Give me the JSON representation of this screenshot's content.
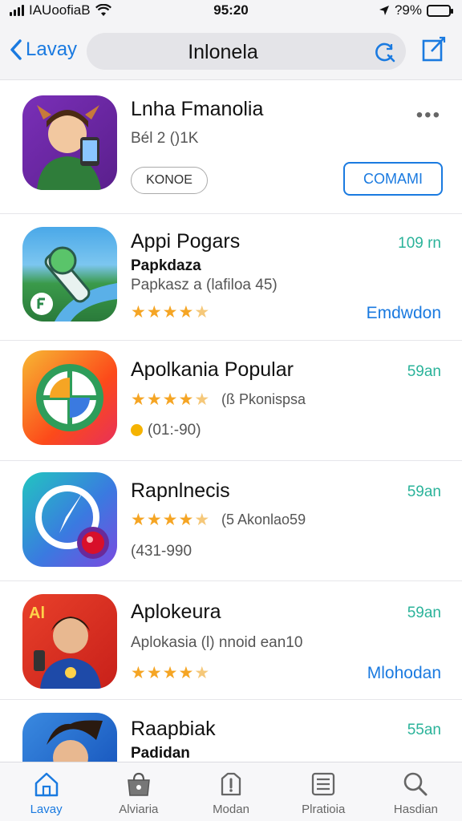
{
  "status": {
    "carrier": "IAUoofiaB",
    "time": "95:20",
    "battery": "?9%",
    "location_icon": "location-arrow-icon",
    "battery_level": 0.79
  },
  "nav": {
    "back_label": "Lavay",
    "title": "Inlonela",
    "search_icon": "refresh-search-icon",
    "compose_icon": "compose-icon"
  },
  "apps": [
    {
      "name": "Lnha Fmanolia",
      "sub": "Bél 2 ()1K",
      "left_button": "KONOE",
      "right_button": "COMAMI"
    },
    {
      "name": "Appi Pogars",
      "sub_bold": "Papkdaza",
      "sub": "Papkasz a (lafiloa 45)",
      "size": "109 rn",
      "rating": 4.5,
      "action": "Emdwdon"
    },
    {
      "name": "Apolkania Popular",
      "size": "59an",
      "rating": 4.5,
      "reviews": "(ß Pkonispsa",
      "price": "(01:-90)"
    },
    {
      "name": "Rapnlnecis",
      "size": "59an",
      "rating": 4.5,
      "reviews": "(5 Akonlao59",
      "price": "(431-990"
    },
    {
      "name": "Aplokeura",
      "size": "59an",
      "sub": "Aplokasia (l) nnoid ean10",
      "rating": 4.5,
      "action": "Mlohodan"
    },
    {
      "name": "Raapbiak",
      "size": "55an",
      "sub_bold": "Padidan"
    }
  ],
  "tabs": [
    {
      "label": "Lavay",
      "icon": "home-icon",
      "active": true
    },
    {
      "label": "Alviaria",
      "icon": "store-bag-icon",
      "active": false
    },
    {
      "label": "Modan",
      "icon": "updates-icon",
      "active": false
    },
    {
      "label": "Plratioia",
      "icon": "list-icon",
      "active": false
    },
    {
      "label": "Hasdian",
      "icon": "search-icon",
      "active": false
    }
  ],
  "colors": {
    "accent": "#1a7ae0",
    "size_green": "#2bb39a",
    "star": "#f5a524"
  }
}
